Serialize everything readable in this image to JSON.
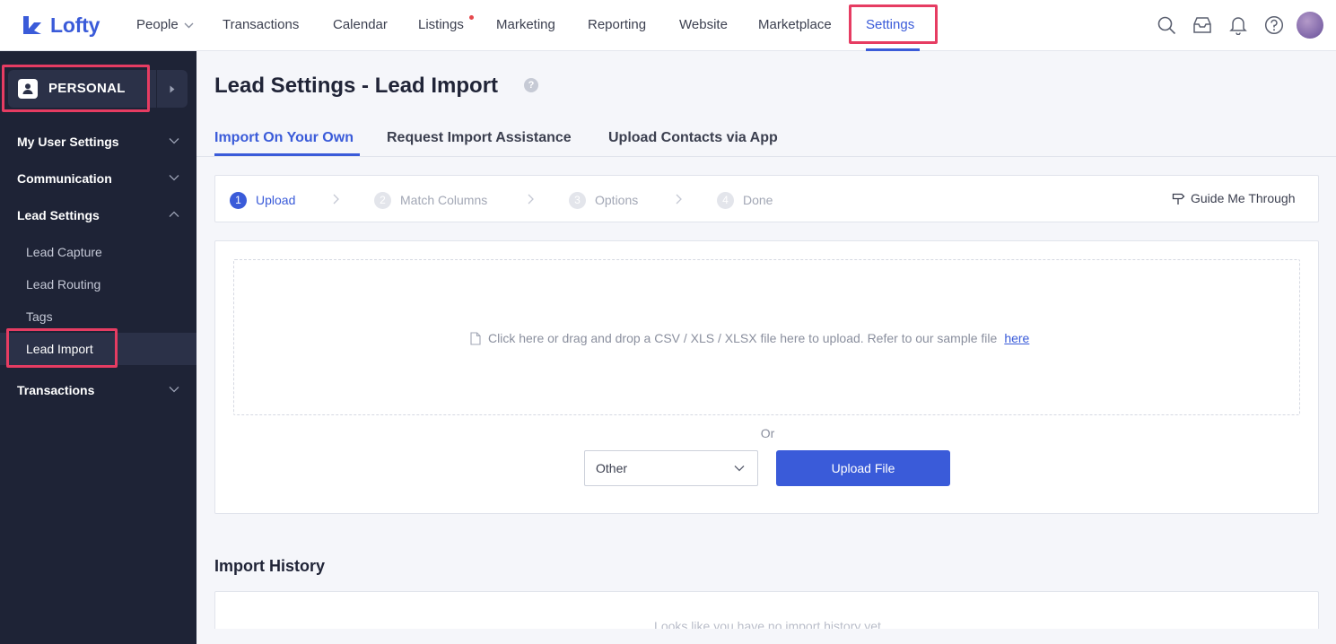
{
  "brand": {
    "name": "Lofty",
    "color": "#3a5bd9"
  },
  "nav": {
    "items": [
      {
        "label": "People",
        "has_dropdown": true
      },
      {
        "label": "Transactions"
      },
      {
        "label": "Calendar"
      },
      {
        "label": "Listings",
        "has_dot": true
      },
      {
        "label": "Marketing"
      },
      {
        "label": "Reporting"
      },
      {
        "label": "Website"
      },
      {
        "label": "Marketplace"
      },
      {
        "label": "Settings",
        "active": true
      }
    ],
    "icons": [
      "search-icon",
      "inbox-icon",
      "bell-icon",
      "help-icon"
    ]
  },
  "sidebar": {
    "workspace": {
      "label": "PERSONAL",
      "icon": "user-icon"
    },
    "groups": [
      {
        "label": "My User Settings",
        "expanded": false
      },
      {
        "label": "Communication",
        "expanded": false
      },
      {
        "label": "Lead Settings",
        "expanded": true,
        "items": [
          {
            "label": "Lead Capture"
          },
          {
            "label": "Lead Routing"
          },
          {
            "label": "Tags"
          },
          {
            "label": "Lead Import",
            "active": true
          }
        ]
      },
      {
        "label": "Transactions",
        "expanded": false
      }
    ]
  },
  "page": {
    "title": "Lead Settings - Lead Import",
    "help_glyph": "?"
  },
  "tabs": [
    {
      "label": "Import On Your Own",
      "active": true
    },
    {
      "label": "Request Import Assistance"
    },
    {
      "label": "Upload Contacts via App"
    }
  ],
  "steps": {
    "items": [
      {
        "number": "1",
        "label": "Upload",
        "active": true
      },
      {
        "number": "2",
        "label": "Match Columns"
      },
      {
        "number": "3",
        "label": "Options"
      },
      {
        "number": "4",
        "label": "Done"
      }
    ],
    "guide_label": "Guide Me Through"
  },
  "upload": {
    "drop_text": "Click here or drag and drop a CSV / XLS / XLSX file here to upload. Refer to our sample file",
    "link_text": "here",
    "or_text": "Or",
    "source_selected": "Other",
    "button_label": "Upload File"
  },
  "history": {
    "title": "Import History",
    "empty_text": "Looks like you have no import history yet"
  },
  "colors": {
    "accent": "#3a5bd9",
    "sidebar_bg": "#1e2336",
    "highlight": "#e63c62",
    "notification_dot": "#e5484d"
  }
}
